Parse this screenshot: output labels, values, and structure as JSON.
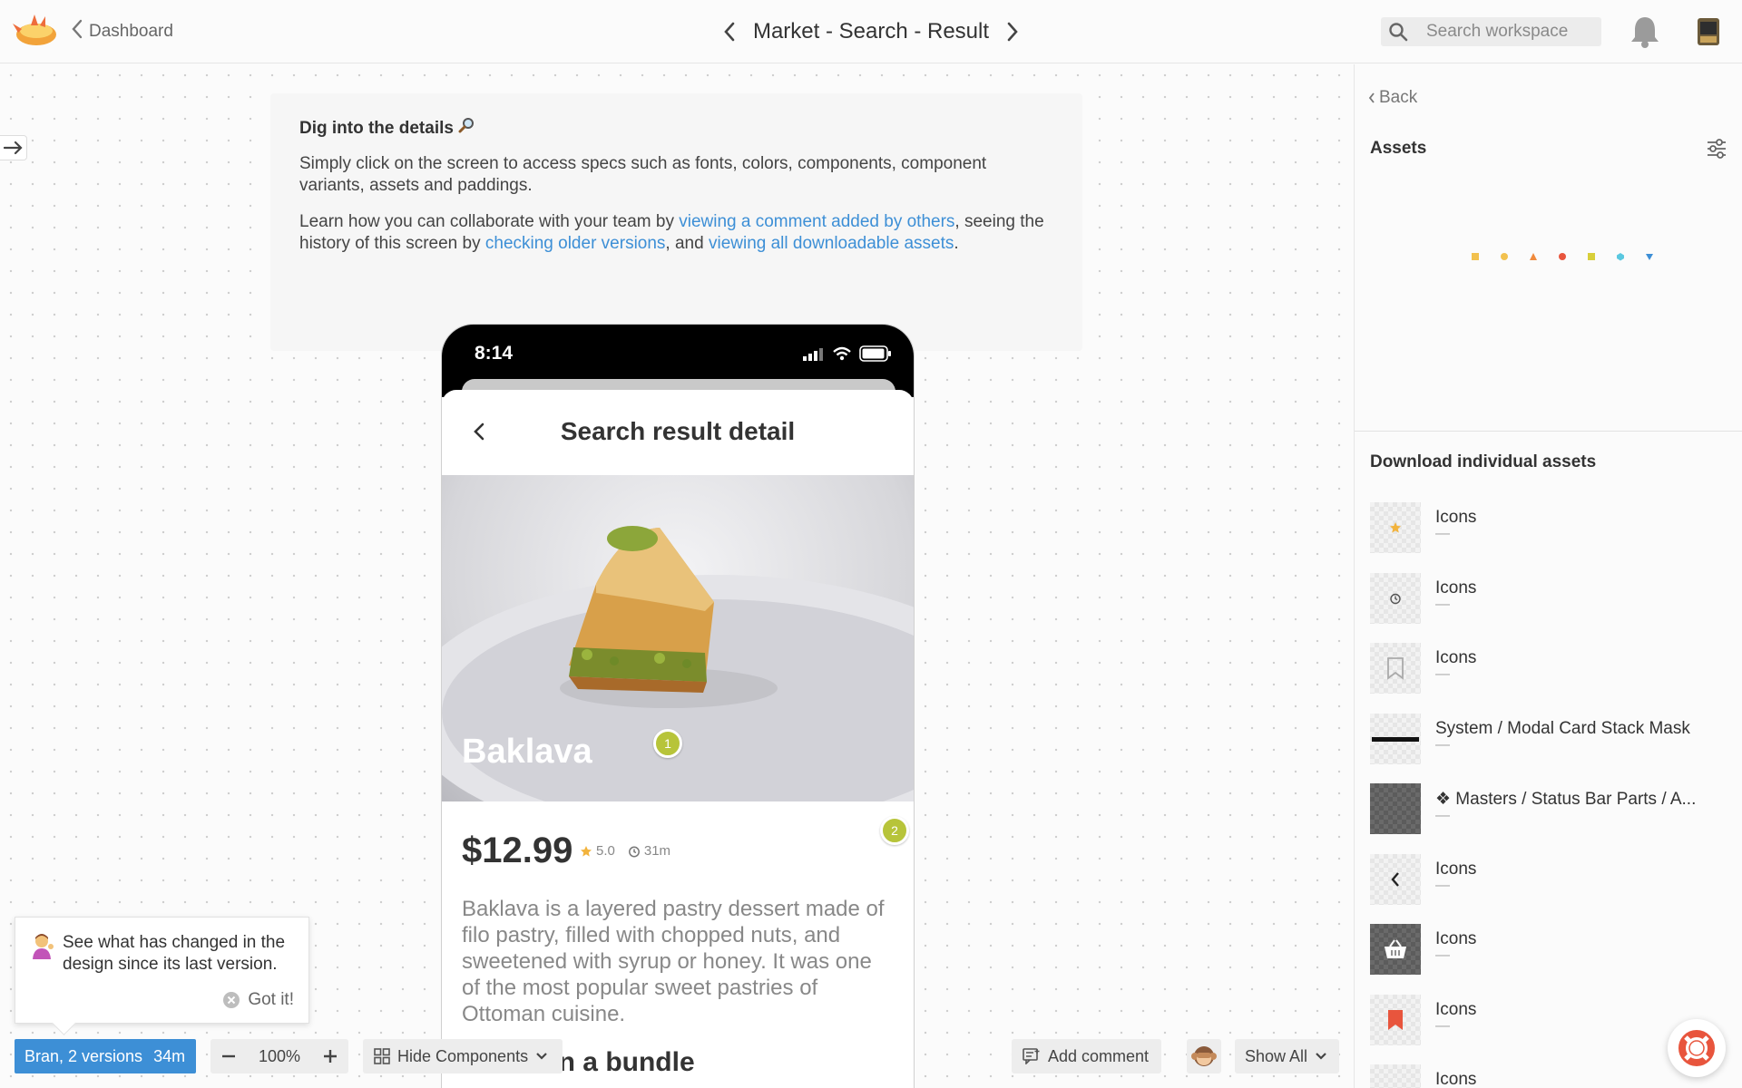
{
  "topbar": {
    "back_label": "Dashboard",
    "screen_title": "Market - Search - Result",
    "search_placeholder": "Search workspace"
  },
  "info_card": {
    "heading": "Dig into the details",
    "para1": "Simply click on the screen to access specs such as fonts, colors, components, component variants, assets and paddings.",
    "para2_a": "Learn how you can collaborate with your team by ",
    "link_comment": "viewing a comment added by others",
    "para2_b": ", seeing the history of this screen by ",
    "link_versions": "checking older versions",
    "para2_c": ", and ",
    "link_assets": "viewing all downloadable assets",
    "para2_d": "."
  },
  "phone": {
    "time": "8:14",
    "header_title": "Search result detail",
    "food_name": "Baklava",
    "price": "$12.99",
    "rating": "5.0",
    "duration": "31m",
    "description": "Baklava is a layered pastry dessert made of filo pastry, filled with chopped nuts, and sweetened with syrup or honey. It was one of the most popular sweet pastries of Ottoman cuisine.",
    "next_section": "Find it in a bundle",
    "pins": [
      "1",
      "2"
    ]
  },
  "tooltip": {
    "message": "See what has changed in the design since its last version.",
    "dismiss": "Got it!"
  },
  "toolbar": {
    "versions_label": "Bran, 2 versions",
    "versions_time": "34m",
    "zoom": "100%",
    "hide_components": "Hide Components",
    "add_comment": "Add comment",
    "show_all": "Show All"
  },
  "panel": {
    "back_label": "Back",
    "assets_title": "Assets",
    "download_title": "Download individual assets",
    "loader_colors": [
      "#f2c14e",
      "#f2c14e",
      "#f08a3c",
      "#e8553d",
      "#d8cf3a",
      "#5ac8e0",
      "#3d8fd6"
    ],
    "assets": [
      {
        "name": "Icons",
        "sub": "—",
        "icon": "star-icon"
      },
      {
        "name": "Icons",
        "sub": "—",
        "icon": "timer-icon"
      },
      {
        "name": "Icons",
        "sub": "—",
        "icon": "bookmark-icon"
      },
      {
        "name": "System / Modal Card Stack Mask",
        "sub": "—",
        "icon": "line-icon"
      },
      {
        "name": "❖ Masters / Status Bar Parts / A...",
        "sub": "—",
        "icon": "checker-icon"
      },
      {
        "name": "Icons",
        "sub": "—",
        "icon": "chevron-left-icon"
      },
      {
        "name": "Icons",
        "sub": "—",
        "icon": "basket-icon"
      },
      {
        "name": "Icons",
        "sub": "—",
        "icon": "bookmark-filled-icon"
      },
      {
        "name": "Icons",
        "sub": "",
        "icon": "icon"
      }
    ]
  }
}
